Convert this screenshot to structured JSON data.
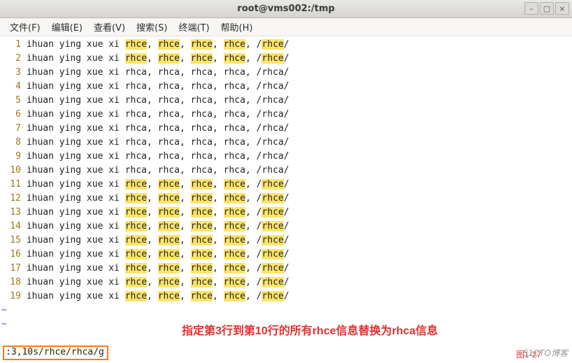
{
  "window": {
    "title": "root@vms002:/tmp"
  },
  "winbtns": {
    "min": "–",
    "max": "▢",
    "close": "×"
  },
  "menu": {
    "file": "文件(F)",
    "edit": "编辑(E)",
    "view": "查看(V)",
    "search": "搜索(S)",
    "terminal": "终端(T)",
    "help": "帮助(H)"
  },
  "text": {
    "base": "ihuan ying xue xi ",
    "rhce": "rhce",
    "rhca": "rhca",
    "comma": ", ",
    "slash": "/",
    "slash2": "/"
  },
  "lines": [
    {
      "n": 1,
      "hl": true,
      "word": "rhce"
    },
    {
      "n": 2,
      "hl": true,
      "word": "rhce"
    },
    {
      "n": 3,
      "hl": false,
      "word": "rhca"
    },
    {
      "n": 4,
      "hl": false,
      "word": "rhca"
    },
    {
      "n": 5,
      "hl": false,
      "word": "rhca"
    },
    {
      "n": 6,
      "hl": false,
      "word": "rhca"
    },
    {
      "n": 7,
      "hl": false,
      "word": "rhca"
    },
    {
      "n": 8,
      "hl": false,
      "word": "rhca"
    },
    {
      "n": 9,
      "hl": false,
      "word": "rhca"
    },
    {
      "n": 10,
      "hl": false,
      "word": "rhca"
    },
    {
      "n": 11,
      "hl": true,
      "word": "rhce"
    },
    {
      "n": 12,
      "hl": true,
      "word": "rhce"
    },
    {
      "n": 13,
      "hl": true,
      "word": "rhce"
    },
    {
      "n": 14,
      "hl": true,
      "word": "rhce"
    },
    {
      "n": 15,
      "hl": true,
      "word": "rhce"
    },
    {
      "n": 16,
      "hl": true,
      "word": "rhce"
    },
    {
      "n": 17,
      "hl": true,
      "word": "rhce"
    },
    {
      "n": 18,
      "hl": true,
      "word": "rhce"
    },
    {
      "n": 19,
      "hl": true,
      "word": "rhce"
    }
  ],
  "tilde": "~",
  "caption": "指定第3行到第10行的所有rhce信息替换为rhca信息",
  "command": ":3,10s/rhce/rhca/g",
  "watermark": "51CTO博客",
  "figlabel": "图1-27"
}
